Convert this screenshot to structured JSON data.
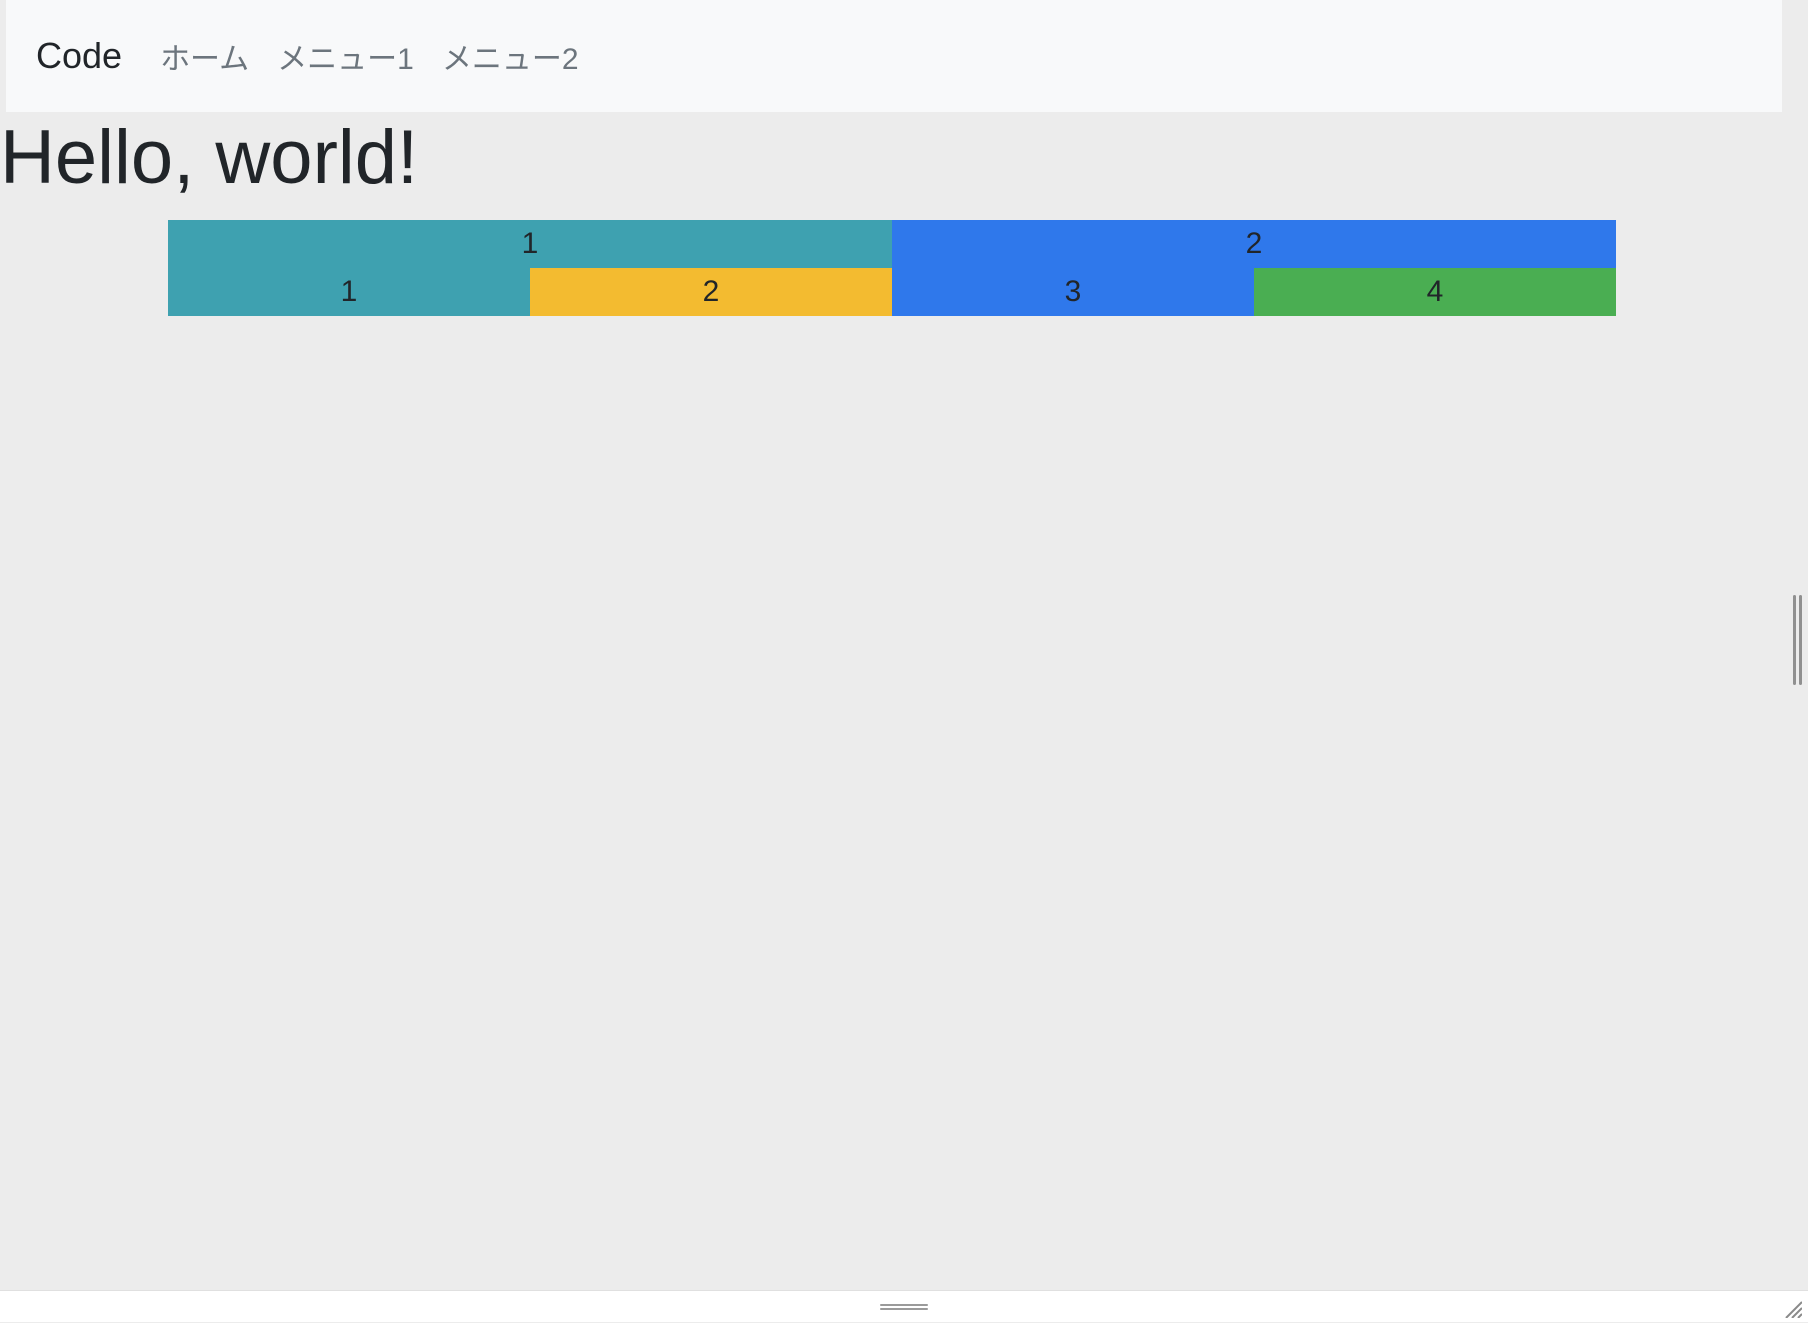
{
  "navbar": {
    "brand": "Code",
    "links": [
      {
        "label": "ホーム"
      },
      {
        "label": "メニュー1"
      },
      {
        "label": "メニュー2"
      }
    ]
  },
  "heading": "Hello, world!",
  "grid": {
    "row1": [
      "1",
      "2"
    ],
    "row2": [
      "1",
      "2",
      "3",
      "4"
    ]
  },
  "colors": {
    "teal": "#3ea1b0",
    "blue": "#2f78eb",
    "yellow": "#f3bb30",
    "green": "#4aae52"
  }
}
